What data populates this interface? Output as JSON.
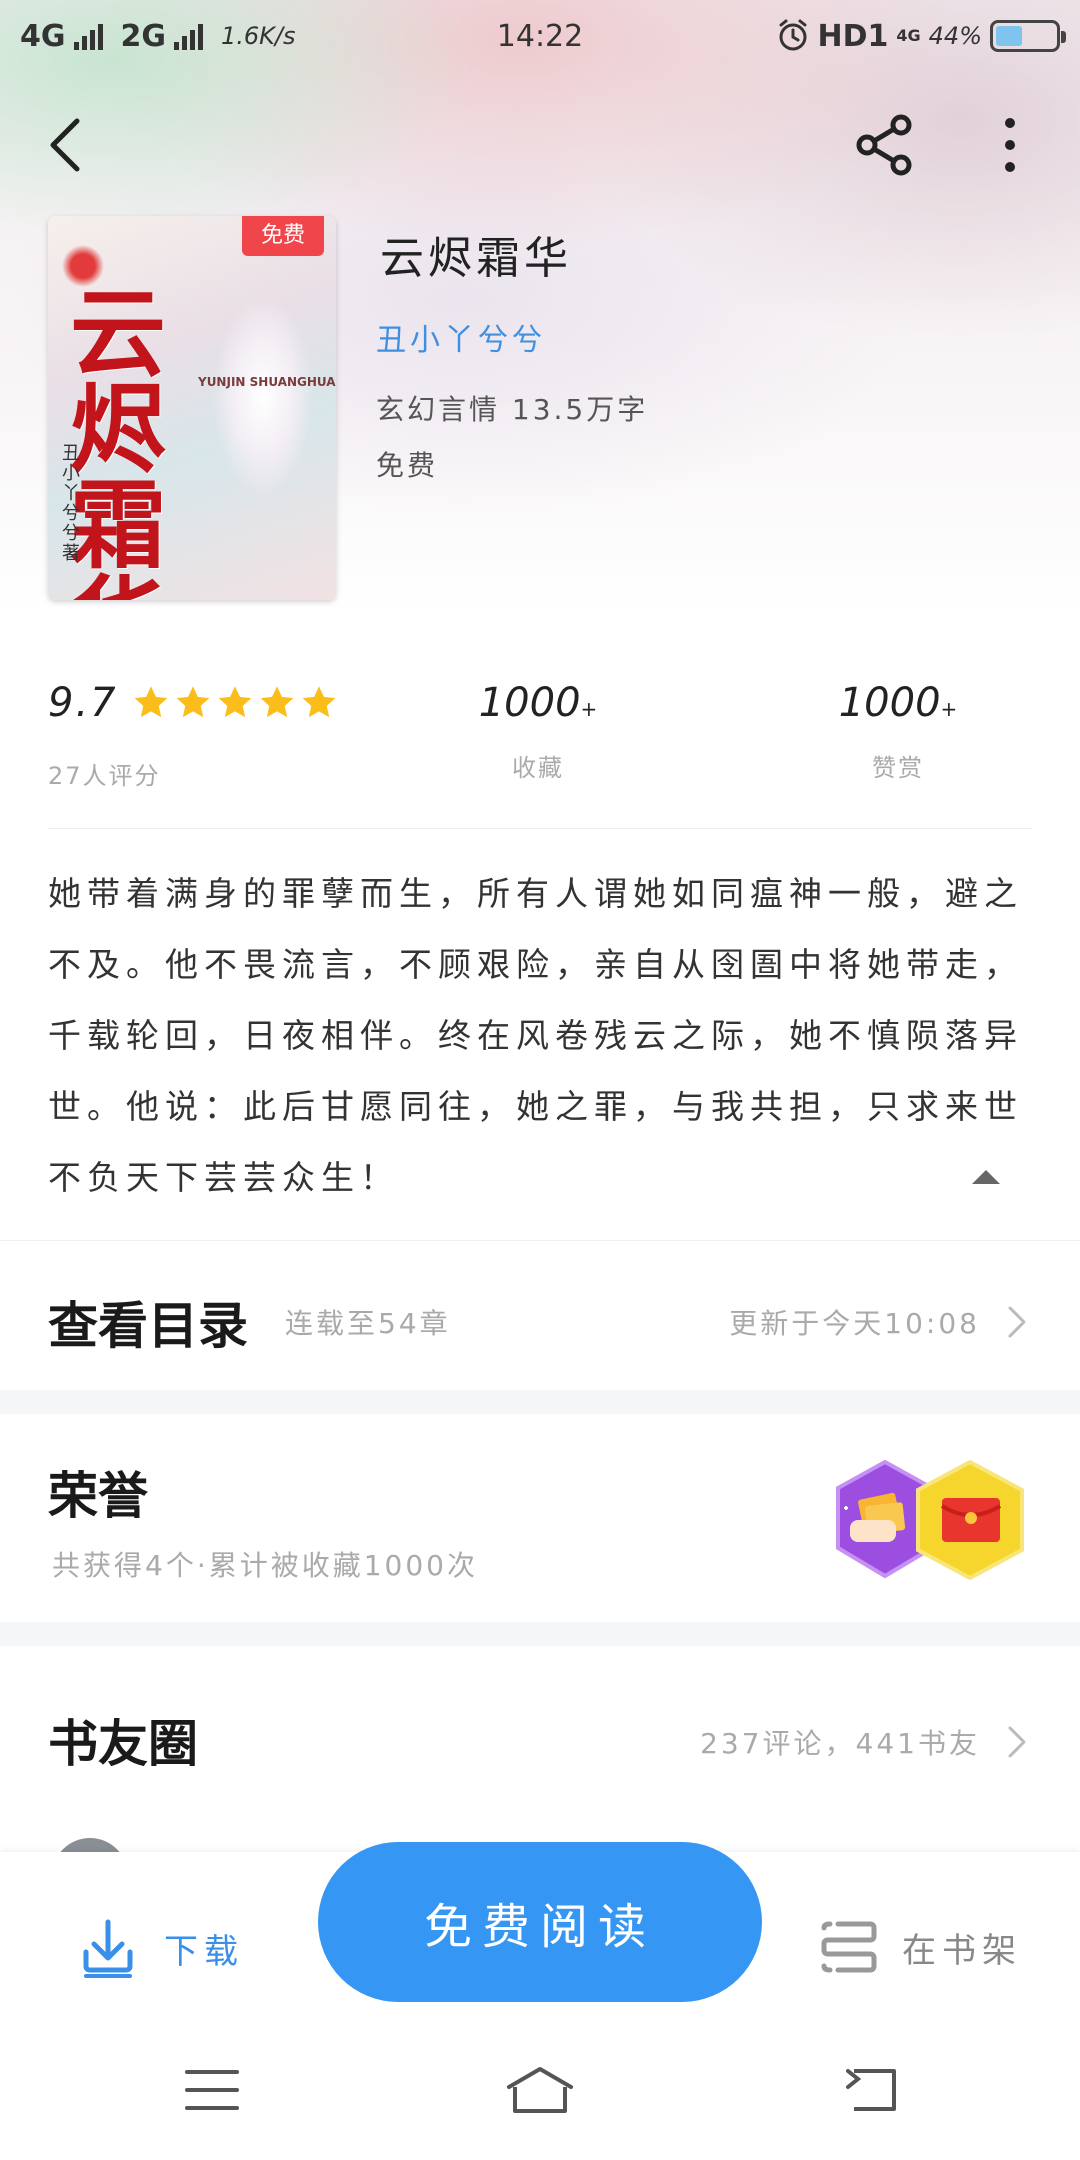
{
  "status_bar": {
    "network_1": "4G",
    "network_2": "2G",
    "speed": "1.6K/s",
    "time": "14:22",
    "hd": "HD1",
    "small_network": "4G",
    "battery": "44%"
  },
  "book": {
    "cover_badge": "免费",
    "cover_title": "云烬霜华",
    "cover_subtitle": "YUNJIN SHUANGHUA",
    "cover_author": "丑小丫兮兮著",
    "title": "云烬霜华",
    "author": "丑小丫兮兮",
    "meta": "玄幻言情  13.5万字",
    "price": "免费"
  },
  "stats": {
    "score": "9.7",
    "rating_stars": 5,
    "score_label": "27人评分",
    "favorites_value": "1000",
    "favorites_suffix": "+",
    "favorites_label": "收藏",
    "tips_value": "1000",
    "tips_suffix": "+",
    "tips_label": "赞赏"
  },
  "synopsis": "她带着满身的罪孽而生，所有人谓她如同瘟神一般，避之不及。他不畏流言，不顾艰险，亲自从囹圄中将她带走，千载轮回，日夜相伴。终在风卷残云之际，她不慎陨落异世。他说：此后甘愿同往，她之罪，与我共担，只求来世不负天下芸芸众生！",
  "catalog": {
    "title": "查看目录",
    "chapters": "连载至54章",
    "updated": "更新于今天10:08"
  },
  "honor": {
    "title": "荣誉",
    "subtitle": "共获得4个·累计被收藏1000次"
  },
  "friends": {
    "title": "书友圈",
    "stats": "237评论，441书友"
  },
  "actions": {
    "download": "下载",
    "read": "免费阅读",
    "shelf": "在书架"
  },
  "colors": {
    "accent": "#3596f3",
    "author_link": "#3f8fe0",
    "badge": "#f0454b",
    "star": "#fbbd19"
  },
  "icons": [
    "back-arrow-icon",
    "share-icon",
    "more-icon",
    "star-icon",
    "collapse-arrow-icon",
    "chevron-right-icon",
    "download-icon",
    "bookshelf-icon",
    "menu-icon",
    "home-icon",
    "back-icon"
  ]
}
